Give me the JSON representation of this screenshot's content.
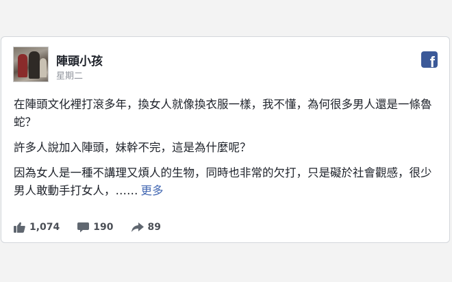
{
  "post": {
    "author_name": "陣頭小孩",
    "date": "星期二",
    "icon": "facebook-icon",
    "paragraphs": [
      "在陣頭文化裡打滾多年，換女人就像換衣服一樣，我不懂，為何很多男人還是一條魯蛇？",
      "許多人說加入陣頭，妹幹不完，這是為什麼呢？",
      "因為女人是一種不講理又煩人的生物，同時也非常的欠打，只是礙於社會觀感，很少男人敢動手打女人，……"
    ],
    "more_link": "更多"
  },
  "stats": {
    "likes": "1,074",
    "comments": "190",
    "shares": "89"
  },
  "colors": {
    "facebook_blue": "#3b5998",
    "link": "#4267b2",
    "muted": "#90949c"
  }
}
